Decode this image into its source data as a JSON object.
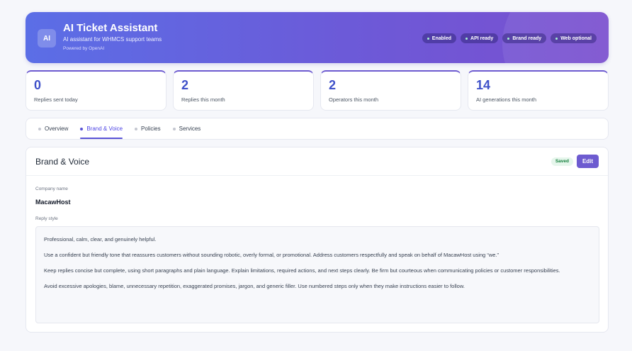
{
  "header": {
    "logo": "AI",
    "title": "AI Ticket Assistant",
    "subtitle": "AI assistant for WHMCS support teams",
    "powered_by": "Powered by OpenAI",
    "status_pills": [
      "Enabled",
      "API ready",
      "Brand ready",
      "Web optional"
    ]
  },
  "stats": [
    {
      "value": "0",
      "label": "Replies sent today"
    },
    {
      "value": "2",
      "label": "Replies this month"
    },
    {
      "value": "2",
      "label": "Operators this month"
    },
    {
      "value": "14",
      "label": "AI generations this month"
    }
  ],
  "tabs": [
    {
      "label": "Overview",
      "active": false
    },
    {
      "label": "Brand & Voice",
      "active": true
    },
    {
      "label": "Policies",
      "active": false
    },
    {
      "label": "Services",
      "active": false
    }
  ],
  "panel": {
    "title": "Brand & Voice",
    "saved_badge": "Saved",
    "edit_label": "Edit",
    "company_label": "Company name",
    "company_value": "MacawHost",
    "reply_style_label": "Reply style",
    "reply_style_paragraphs": [
      "Professional, calm, clear, and genuinely helpful.",
      "Use a confident but friendly tone that reassures customers without sounding robotic, overly formal, or promotional. Address customers respectfully and speak on behalf of MacawHost using “we.”",
      "Keep replies concise but complete, using short paragraphs and plain language. Explain limitations, required actions, and next steps clearly. Be firm but courteous when communicating policies or customer responsibilities.",
      "Avoid excessive apologies, blame, unnecessary repetition, exaggerated promises, jargon, and generic filler. Use numbered steps only when they make instructions easier to follow."
    ]
  },
  "colors": {
    "accent": "#6d5bd0",
    "stat_value": "#3f51c9",
    "saved_green": "#15803d"
  }
}
